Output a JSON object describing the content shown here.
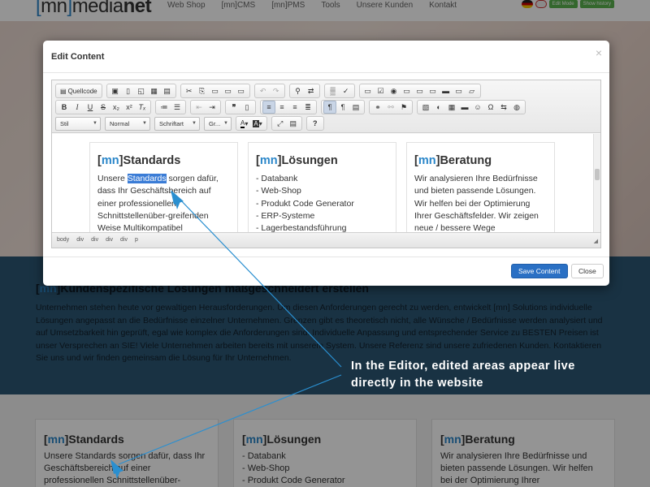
{
  "site": {
    "logo_bracket_open": "[",
    "logo_mn": "mn",
    "logo_bracket_close": "]",
    "logo_media": "media",
    "logo_net": "net",
    "nav": [
      "Web Shop",
      "[mn]CMS",
      "[mn]PMS",
      "Tools",
      "Unsere Kunden",
      "Kontakt"
    ],
    "green_buttons": [
      "Edit Mode",
      "Show history"
    ],
    "band_title_pre": "[",
    "band_title_mn": "mn",
    "band_title_post": "]Kundenspezifische Lösungen maßgeschneidert erstellen",
    "band_text": "Unternehmen stehen heute vor gewaltigen Herausforderungen. Um diesen Anforderungen gerecht zu werden, entwickelt [mn] Solutions individuelle Lösungen angepasst an die Bedürfnisse einzelner Unternehmen. Grenzen gibt es theoretisch nicht, alle Wünsche / Bedürfnisse werden analysiert und auf Umsetzbarkeit hin geprüft, egal wie komplex die Anforderungen sind. Individuelle Anpassung und entsprechender Service zu BESTEN Preisen ist unser Versprechen an SIE! Viele Unternehmen arbeiten bereits mit unserem System. Unsere Referenz sind unsere zufriedenen Kunden. Kontaktieren Sie uns und wir finden gemeinsam die Lösung für Ihr Unternehmen.",
    "lower_cols": [
      {
        "mn": "mn",
        "title": "Standards",
        "text": "Unsere Standards sorgen dafür, dass Ihr Geschäftsbereich auf einer professionellen Schnittstellenüber-"
      },
      {
        "mn": "mn",
        "title": "Lösungen",
        "text": "- Databank\n- Web-Shop\n- Produkt Code Generator"
      },
      {
        "mn": "mn",
        "title": "Beratung",
        "text": "Wir analysieren Ihre Bedürfnisse und bieten passende Lösungen. Wir helfen bei der Optimierung Ihrer"
      }
    ]
  },
  "modal": {
    "title": "Edit Content",
    "close_glyph": "×",
    "save_label": "Save Content",
    "close_label": "Close"
  },
  "toolbar": {
    "source_label": "Quellcode",
    "style_combo": "Stil",
    "format_combo": "Normal",
    "font_combo": "Schriftart",
    "size_combo": "Gr..."
  },
  "editor": {
    "columns": [
      {
        "mn": "mn",
        "title": "Standards",
        "text_pre": "Unsere ",
        "text_sel": "Standards",
        "text_post": " sorgen dafür, dass Ihr Geschäftsbereich auf einer professionellen Schnittstellenüber-greifenden Weise Multikompatibel"
      },
      {
        "mn": "mn",
        "title": "Lösungen",
        "lines": [
          "- Databank",
          "- Web-Shop",
          "- Produkt Code Generator",
          "- ERP-Systeme",
          "- Lagerbestandsführung"
        ]
      },
      {
        "mn": "mn",
        "title": "Beratung",
        "text": "Wir analysieren Ihre Bedürfnisse und bieten passende Lösungen. Wir helfen bei der Optimierung Ihrer Geschäftsfelder. Wir zeigen neue / bessere Wege"
      }
    ],
    "path": [
      "body",
      "div",
      "div",
      "div",
      "div",
      "p"
    ]
  },
  "caption": {
    "line1": "In the Editor, edited areas appear live",
    "line2": "directly in the website"
  },
  "colors": {
    "accent": "#2a86c9",
    "annotation": "#2a8fd0",
    "save_button": "#2a70c4",
    "band": "#2c5774",
    "selection": "#3a7cd6"
  }
}
